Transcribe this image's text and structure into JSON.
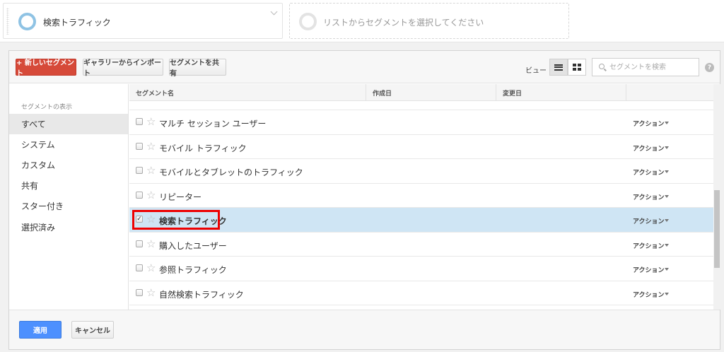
{
  "segments": {
    "selected_title": "検索トラフィック",
    "empty_placeholder": "リストからセグメントを選択してください"
  },
  "toolbar": {
    "new_segment": "+ 新しいセグメント",
    "import_gallery": "ギャラリーからインポート",
    "share_segment": "セグメントを共有",
    "view_label": "ビュー",
    "search_placeholder": "セグメントを検索",
    "help": "?"
  },
  "sidebar": {
    "header": "セグメントの表示",
    "items": [
      {
        "label": "すべて",
        "active": true
      },
      {
        "label": "システム"
      },
      {
        "label": "カスタム"
      },
      {
        "label": "共有"
      },
      {
        "label": "スター付き"
      },
      {
        "label": "選択済み"
      }
    ]
  },
  "table": {
    "columns": [
      "セグメント名",
      "作成日",
      "変更日"
    ],
    "action_label": "アクション",
    "rows": [
      {
        "name": "マルチ セッション ユーザー",
        "checked": false
      },
      {
        "name": "モバイル トラフィック",
        "checked": false
      },
      {
        "name": "モバイルとタブレットのトラフィック",
        "checked": false
      },
      {
        "name": "リピーター",
        "checked": false
      },
      {
        "name": "検索トラフィック",
        "checked": true
      },
      {
        "name": "購入したユーザー",
        "checked": false
      },
      {
        "name": "参照トラフィック",
        "checked": false
      },
      {
        "name": "自然検索トラフィック",
        "checked": false
      }
    ]
  },
  "footer": {
    "apply": "適用",
    "cancel": "キャンセル"
  },
  "colors": {
    "accent_red": "#d64a39",
    "apply_blue": "#4d90fe",
    "selected_row": "#cfe5f4",
    "highlight": "#ee0000"
  }
}
